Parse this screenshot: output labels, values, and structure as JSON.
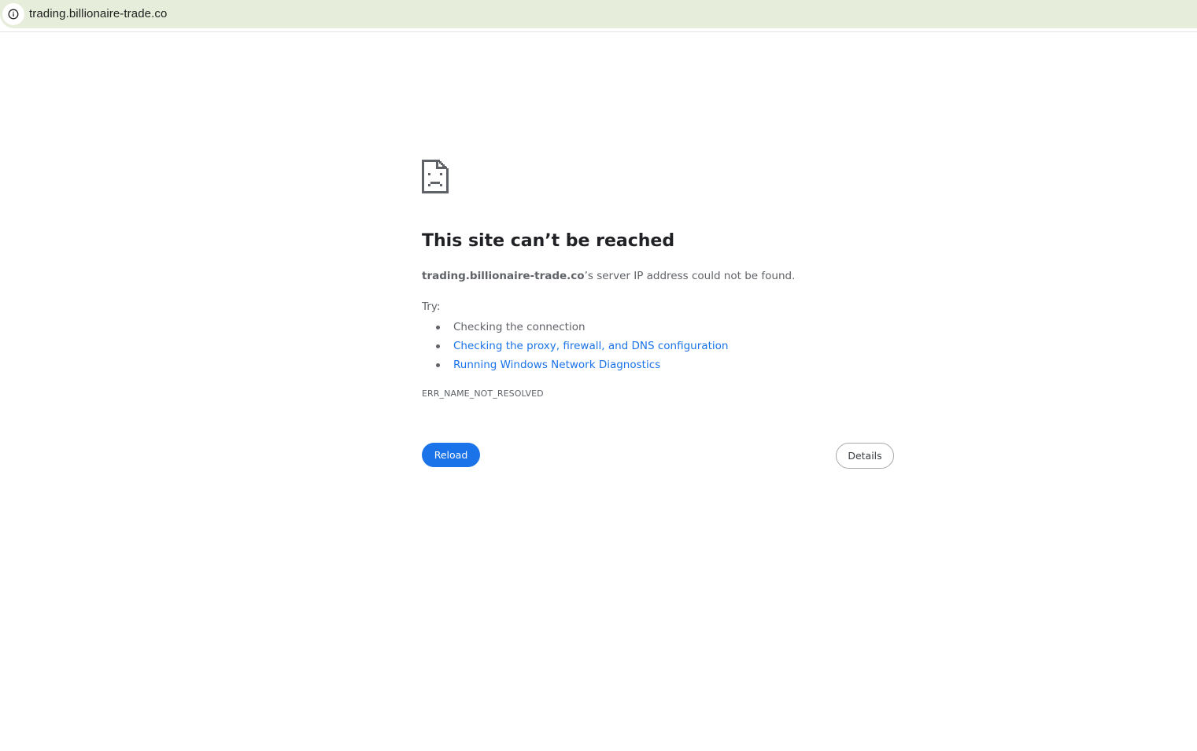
{
  "browser": {
    "url": "trading.billionaire-trade.co",
    "site_info_icon": "info-icon"
  },
  "error_page": {
    "icon": "sad-page-icon",
    "title": "This site can’t be reached",
    "summary_host": "trading.billionaire-trade.co",
    "summary_rest": "’s server IP address could not be found.",
    "try_label": "Try:",
    "suggestions": [
      "Checking the connection",
      "Checking the proxy, firewall, and DNS configuration",
      "Running Windows Network Diagnostics"
    ],
    "error_code": "ERR_NAME_NOT_RESOLVED",
    "reload_label": "Reload",
    "details_label": "Details"
  },
  "colors": {
    "address_bar_bg": "#e6eedb",
    "link": "#1a73e8",
    "primary_button": "#1a73e8",
    "body_text": "#5f6368",
    "title_text": "#202124"
  }
}
